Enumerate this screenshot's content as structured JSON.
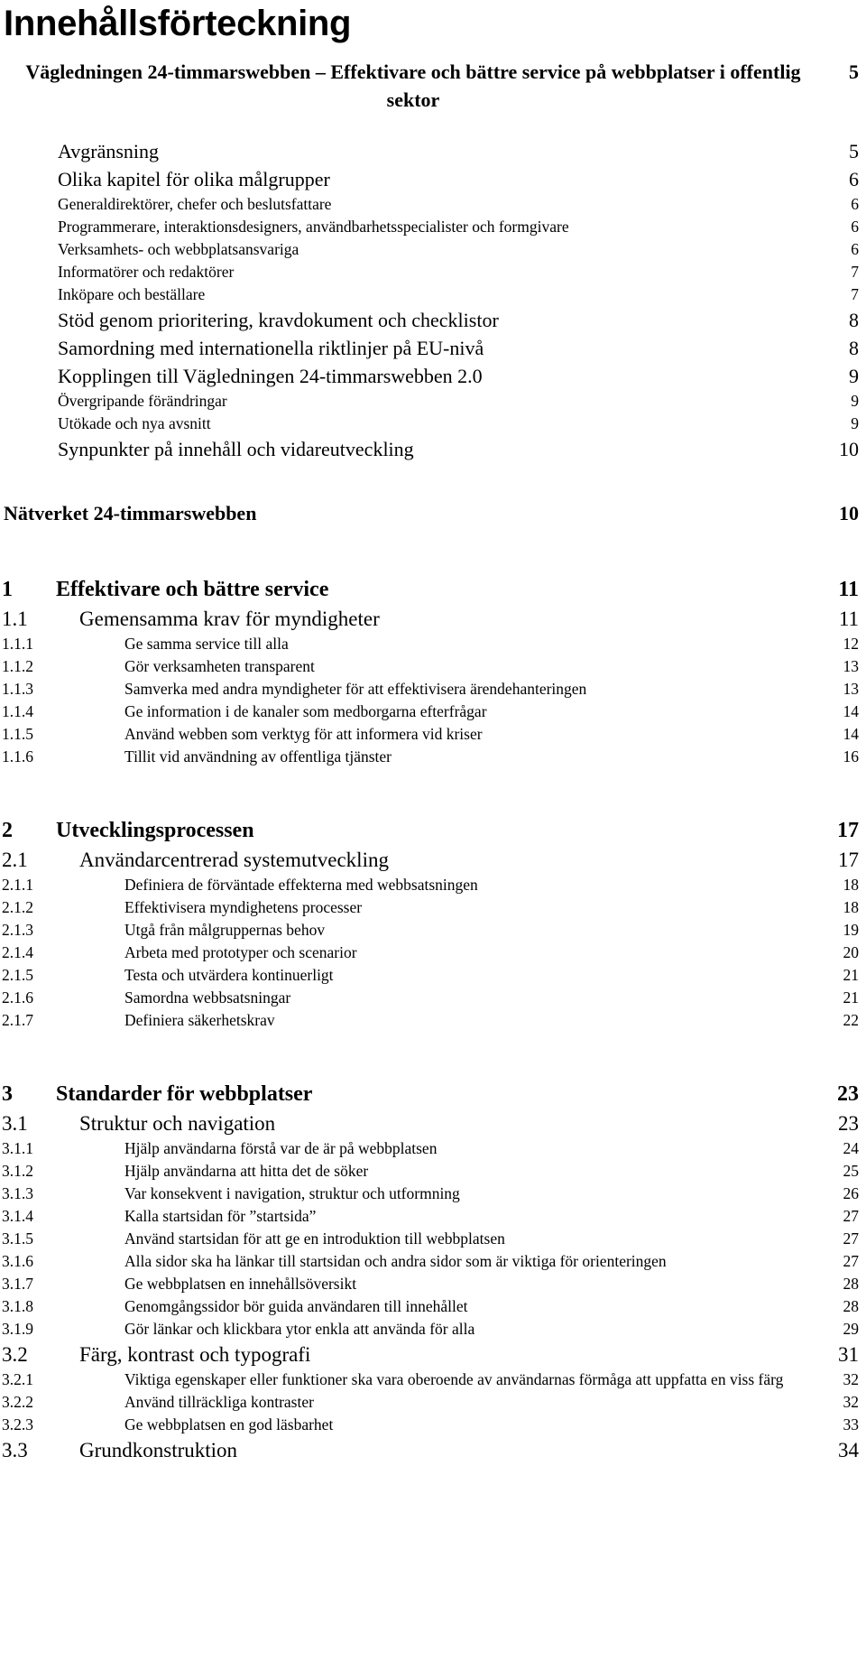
{
  "document": {
    "title": "Innehållsförteckning",
    "language": "sv"
  },
  "toc": {
    "title_entry": {
      "label": "Vägledningen 24-timmarswebben –  Effektivare och bättre service på webbplatser i offentlig sektor",
      "page": "5"
    },
    "entries": [
      {
        "id": "avgransning",
        "num": "",
        "label": "Avgränsning",
        "page": "5",
        "level": "a"
      },
      {
        "id": "olika-kapitel",
        "num": "",
        "label": "Olika kapitel för olika målgrupper",
        "page": "6",
        "level": "a"
      },
      {
        "id": "generaldirektorer",
        "num": "",
        "label": "Generaldirektörer, chefer och beslutsfattare",
        "page": "6",
        "level": "b"
      },
      {
        "id": "programmerare",
        "num": "",
        "label": "Programmerare, interaktionsdesigners, användbarhetsspecialister och formgivare",
        "page": "6",
        "level": "b"
      },
      {
        "id": "verksamhets",
        "num": "",
        "label": "Verksamhets- och webbplatsansvariga",
        "page": "6",
        "level": "b"
      },
      {
        "id": "informatorer",
        "num": "",
        "label": "Informatörer och redaktörer",
        "page": "7",
        "level": "b"
      },
      {
        "id": "inkopare",
        "num": "",
        "label": "Inköpare och beställare",
        "page": "7",
        "level": "b"
      },
      {
        "id": "stod-genom",
        "num": "",
        "label": "Stöd genom prioritering, kravdokument och checklistor",
        "page": "8",
        "level": "a"
      },
      {
        "id": "samordning-eu",
        "num": "",
        "label": "Samordning med internationella riktlinjer på EU-nivå",
        "page": "8",
        "level": "a"
      },
      {
        "id": "kopplingen",
        "num": "",
        "label": "Kopplingen till Vägledningen 24-timmarswebben 2.0",
        "page": "9",
        "level": "a"
      },
      {
        "id": "overgripande",
        "num": "",
        "label": "Övergripande förändringar",
        "page": "9",
        "level": "b"
      },
      {
        "id": "utokade",
        "num": "",
        "label": "Utökade och nya avsnitt",
        "page": "9",
        "level": "b"
      },
      {
        "id": "synpunkter",
        "num": "",
        "label": "Synpunkter på innehåll och vidareutveckling",
        "page": "10",
        "level": "a"
      },
      {
        "id": "natverket",
        "num": "",
        "label": "Nätverket 24-timmarswebben",
        "page": "10",
        "level": "h",
        "gap_before": "lg"
      },
      {
        "id": "ch1",
        "num": "1",
        "label": "Effektivare och bättre service",
        "page": "11",
        "level": "1",
        "gap_before": "xl"
      },
      {
        "id": "s1-1",
        "num": "1.1",
        "label": "Gemensamma krav för myndigheter",
        "page": "11",
        "level": "2"
      },
      {
        "id": "s1-1-1",
        "num": "1.1.1",
        "label": "Ge samma service till alla",
        "page": "12",
        "level": "3"
      },
      {
        "id": "s1-1-2",
        "num": "1.1.2",
        "label": "Gör verksamheten transparent",
        "page": "13",
        "level": "3"
      },
      {
        "id": "s1-1-3",
        "num": "1.1.3",
        "label": "Samverka med andra myndigheter för att effektivisera ärendehanteringen",
        "page": "13",
        "level": "3"
      },
      {
        "id": "s1-1-4",
        "num": "1.1.4",
        "label": "Ge information i de kanaler som medborgarna efterfrågar",
        "page": "14",
        "level": "3"
      },
      {
        "id": "s1-1-5",
        "num": "1.1.5",
        "label": "Använd webben som verktyg för att informera vid kriser",
        "page": "14",
        "level": "3"
      },
      {
        "id": "s1-1-6",
        "num": "1.1.6",
        "label": "Tillit vid användning av offentliga tjänster",
        "page": "16",
        "level": "3"
      },
      {
        "id": "ch2",
        "num": "2",
        "label": "Utvecklingsprocessen",
        "page": "17",
        "level": "1",
        "gap_before": "xl"
      },
      {
        "id": "s2-1",
        "num": "2.1",
        "label": "Användarcentrerad systemutveckling",
        "page": "17",
        "level": "2"
      },
      {
        "id": "s2-1-1",
        "num": "2.1.1",
        "label": "Definiera de förväntade effekterna med webbsatsningen",
        "page": "18",
        "level": "3"
      },
      {
        "id": "s2-1-2",
        "num": "2.1.2",
        "label": "Effektivisera myndighetens processer",
        "page": "18",
        "level": "3"
      },
      {
        "id": "s2-1-3",
        "num": "2.1.3",
        "label": "Utgå från målgruppernas behov",
        "page": "19",
        "level": "3"
      },
      {
        "id": "s2-1-4",
        "num": "2.1.4",
        "label": "Arbeta med prototyper och scenarior",
        "page": "20",
        "level": "3"
      },
      {
        "id": "s2-1-5",
        "num": "2.1.5",
        "label": "Testa och utvärdera kontinuerligt",
        "page": "21",
        "level": "3"
      },
      {
        "id": "s2-1-6",
        "num": "2.1.6",
        "label": "Samordna webbsatsningar",
        "page": "21",
        "level": "3"
      },
      {
        "id": "s2-1-7",
        "num": "2.1.7",
        "label": "Definiera säkerhetskrav",
        "page": "22",
        "level": "3"
      },
      {
        "id": "ch3",
        "num": "3",
        "label": "Standarder för webbplatser",
        "page": "23",
        "level": "1",
        "gap_before": "xl"
      },
      {
        "id": "s3-1",
        "num": "3.1",
        "label": "Struktur och navigation",
        "page": "23",
        "level": "2"
      },
      {
        "id": "s3-1-1",
        "num": "3.1.1",
        "label": "Hjälp användarna förstå var de är på webbplatsen",
        "page": "24",
        "level": "3"
      },
      {
        "id": "s3-1-2",
        "num": "3.1.2",
        "label": "Hjälp användarna att hitta det de söker",
        "page": "25",
        "level": "3"
      },
      {
        "id": "s3-1-3",
        "num": "3.1.3",
        "label": "Var konsekvent i navigation, struktur och utformning",
        "page": "26",
        "level": "3"
      },
      {
        "id": "s3-1-4",
        "num": "3.1.4",
        "label": "Kalla startsidan för ”startsida”",
        "page": "27",
        "level": "3"
      },
      {
        "id": "s3-1-5",
        "num": "3.1.5",
        "label": "Använd startsidan för att ge en introduktion till webbplatsen",
        "page": "27",
        "level": "3"
      },
      {
        "id": "s3-1-6",
        "num": "3.1.6",
        "label": "Alla sidor ska ha länkar till startsidan och andra sidor som är viktiga för orienteringen",
        "page": "27",
        "level": "3",
        "wrap": true
      },
      {
        "id": "s3-1-7",
        "num": "3.1.7",
        "label": "Ge webbplatsen en innehållsöversikt",
        "page": "28",
        "level": "3"
      },
      {
        "id": "s3-1-8",
        "num": "3.1.8",
        "label": "Genomgångssidor bör guida användaren till innehållet",
        "page": "28",
        "level": "3"
      },
      {
        "id": "s3-1-9",
        "num": "3.1.9",
        "label": "Gör länkar och klickbara ytor enkla att använda för alla",
        "page": "29",
        "level": "3"
      },
      {
        "id": "s3-2",
        "num": "3.2",
        "label": "Färg, kontrast och typografi",
        "page": "31",
        "level": "2"
      },
      {
        "id": "s3-2-1",
        "num": "3.2.1",
        "label": "Viktiga egenskaper eller funktioner ska vara oberoende av användarnas förmåga att uppfatta en viss färg",
        "page": "32",
        "level": "3",
        "wrap": true
      },
      {
        "id": "s3-2-2",
        "num": "3.2.2",
        "label": "Använd tillräckliga kontraster",
        "page": "32",
        "level": "3"
      },
      {
        "id": "s3-2-3",
        "num": "3.2.3",
        "label": "Ge webbplatsen en god läsbarhet",
        "page": "33",
        "level": "3"
      },
      {
        "id": "s3-3",
        "num": "3.3",
        "label": "Grundkonstruktion",
        "page": "34",
        "level": "2"
      }
    ]
  }
}
